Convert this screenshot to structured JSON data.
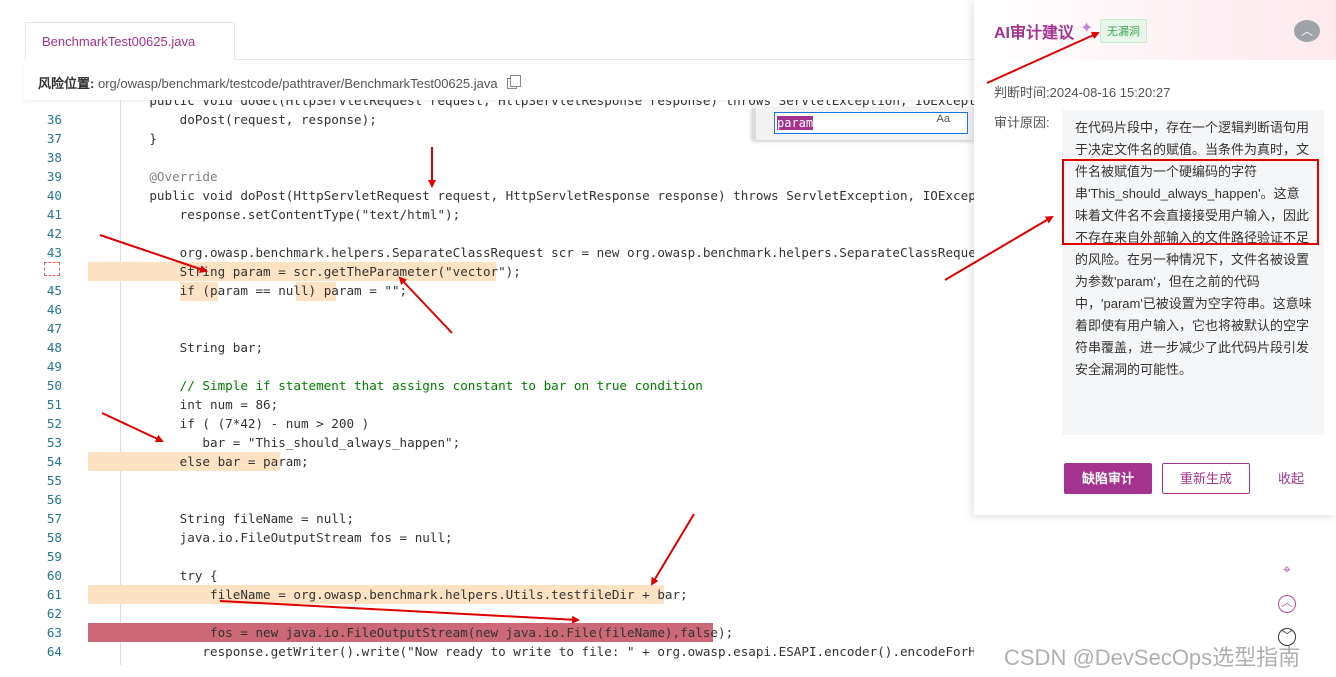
{
  "tab": {
    "label": "BenchmarkTest00625.java"
  },
  "risk": {
    "label": "风险位置:",
    "path": "org/owasp/benchmark/testcode/pathtraver/BenchmarkTest00625.java"
  },
  "code": {
    "l35": "    public void doGet(HttpServletRequest request, HttpServletResponse response) throws ServletException, IOException {",
    "l36": "        doPost(request, response);",
    "l37": "    }",
    "l38": "",
    "l39": "    @Override",
    "l40": "    public void doPost(HttpServletRequest request, HttpServletResponse response) throws ServletException, IOExcepti",
    "l41": "        response.setContentType(\"text/html\");",
    "l42": "",
    "l43": "        org.owasp.benchmark.helpers.SeparateClassRequest scr = new org.owasp.benchmark.helpers.SeparateClassRequest",
    "l44": "        String param = scr.getTheParameter(\"vector\");",
    "l45": "        if (param == null) param = \"\";",
    "l46": "",
    "l47": "",
    "l48": "        String bar;",
    "l49": "",
    "l50": "        // Simple if statement that assigns constant to bar on true condition",
    "l51": "        int num = 86;",
    "l52": "        if ( (7*42) - num > 200 )",
    "l53": "           bar = \"This_should_always_happen\";",
    "l54": "        else bar = param;",
    "l55": "",
    "l56": "",
    "l57": "        String fileName = null;",
    "l58": "        java.io.FileOutputStream fos = null;",
    "l59": "",
    "l60": "        try {",
    "l61": "            fileName = org.owasp.benchmark.helpers.Utils.testfileDir + bar;",
    "l62": "",
    "l63": "            fos = new java.io.FileOutputStream(new java.io.File(fileName),false);",
    "l64": "           response.getWriter().write(\"Now ready to write to file: \" + org.owasp.esapi.ESAPI.encoder().encodeForHTML(fileName));"
  },
  "line_numbers": [
    "36",
    "37",
    "38",
    "39",
    "40",
    "41",
    "42",
    "43",
    "",
    "45",
    "46",
    "47",
    "48",
    "49",
    "50",
    "51",
    "52",
    "53",
    "54",
    "55",
    "56",
    "57",
    "58",
    "59",
    "60",
    "61",
    "62",
    "63",
    "64"
  ],
  "find": {
    "query": "param",
    "options": "Aa"
  },
  "panel": {
    "title": "AI审计建议",
    "badge": "无漏洞",
    "time_label": "判断时间:",
    "time_value": "2024-08-16 15:20:27",
    "reason_label": "审计原因:",
    "reason_text": "在代码片段中，存在一个逻辑判断语句用于决定文件名的赋值。当条件为真时，文件名被赋值为一个硬编码的字符串'This_should_always_happen'。这意味着文件名不会直接接受用户输入，因此不存在来自外部输入的文件路径验证不足的风险。在另一种情况下，文件名被设置为参数'param'，但在之前的代码中，'param'已被设置为空字符串。这意味着即使有用户输入，它也将被默认的空字符串覆盖，进一步减少了此代码片段引发安全漏洞的可能性。",
    "btn_audit": "缺陷审计",
    "btn_regen": "重新生成",
    "btn_collapse": "收起"
  },
  "icons": [
    "sparkle-icon",
    "collapse-icon",
    "copy-icon",
    "location-pin-icon",
    "chevron-up-icon",
    "chevron-down-icon"
  ],
  "watermark": "CSDN @DevSecOps选型指南",
  "colors": {
    "accent": "#a4338f",
    "highlight_orange": "#fde2c3",
    "highlight_red": "#cd6876",
    "annotation": "#e00000"
  }
}
